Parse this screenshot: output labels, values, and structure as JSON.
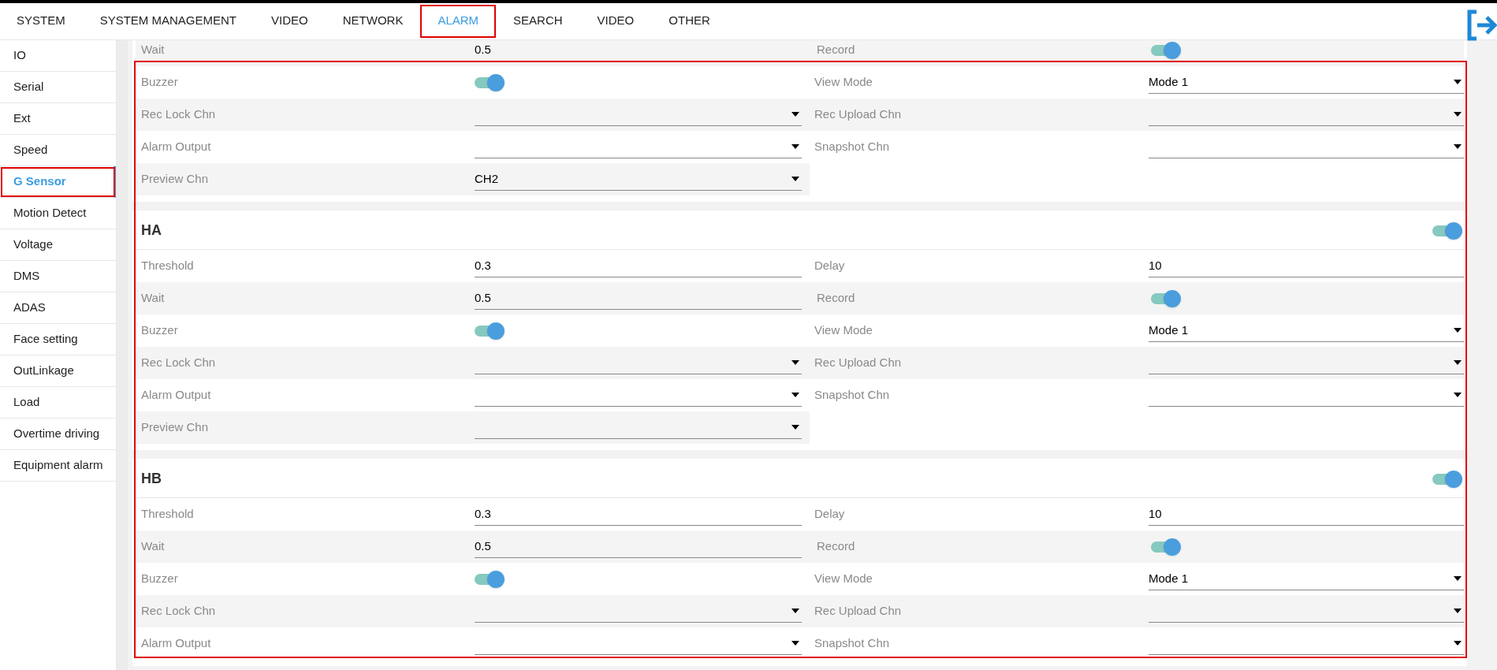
{
  "nav": [
    {
      "label": "SYSTEM",
      "selected": false,
      "highlighted": false
    },
    {
      "label": "SYSTEM MANAGEMENT",
      "selected": false,
      "highlighted": false
    },
    {
      "label": "VIDEO",
      "selected": false,
      "highlighted": false
    },
    {
      "label": "NETWORK",
      "selected": false,
      "highlighted": false
    },
    {
      "label": "ALARM",
      "selected": true,
      "highlighted": true
    },
    {
      "label": "SEARCH",
      "selected": false,
      "highlighted": false
    },
    {
      "label": "VIDEO",
      "selected": false,
      "highlighted": false
    },
    {
      "label": "OTHER",
      "selected": false,
      "highlighted": false
    }
  ],
  "sidebar": {
    "items": [
      {
        "label": "IO",
        "selected": false,
        "highlighted": false
      },
      {
        "label": "Serial",
        "selected": false,
        "highlighted": false
      },
      {
        "label": "Ext",
        "selected": false,
        "highlighted": false
      },
      {
        "label": "Speed",
        "selected": false,
        "highlighted": false
      },
      {
        "label": "G Sensor",
        "selected": true,
        "highlighted": true
      },
      {
        "label": "Motion Detect",
        "selected": false,
        "highlighted": false
      },
      {
        "label": "Voltage",
        "selected": false,
        "highlighted": false
      },
      {
        "label": "DMS",
        "selected": false,
        "highlighted": false
      },
      {
        "label": "ADAS",
        "selected": false,
        "highlighted": false
      },
      {
        "label": "Face setting",
        "selected": false,
        "highlighted": false
      },
      {
        "label": "OutLinkage",
        "selected": false,
        "highlighted": false
      },
      {
        "label": "Load",
        "selected": false,
        "highlighted": false
      },
      {
        "label": "Overtime driving",
        "selected": false,
        "highlighted": false
      },
      {
        "label": "Equipment alarm",
        "selected": false,
        "highlighted": false
      }
    ]
  },
  "annotation_box": true,
  "sections": [
    {
      "rows": [
        [
          {
            "label": "Wait",
            "kind": "text",
            "value": "0.5"
          },
          {
            "label": "Record",
            "kind": "toggle",
            "on": true
          }
        ],
        [
          {
            "label": "Buzzer",
            "kind": "toggle",
            "on": true
          },
          {
            "label": "View Mode",
            "kind": "select",
            "value": "Mode 1"
          }
        ],
        [
          {
            "label": "Rec Lock Chn",
            "kind": "select"
          },
          {
            "label": "Rec Upload Chn",
            "kind": "select"
          }
        ],
        [
          {
            "label": "Alarm Output",
            "kind": "select"
          },
          {
            "label": "Snapshot Chn",
            "kind": "select"
          }
        ],
        [
          {
            "label": "Preview Chn",
            "kind": "select",
            "value": "CH2"
          }
        ]
      ]
    },
    {
      "title": "HA",
      "enabled": true,
      "rows": [
        [
          {
            "label": "Threshold",
            "kind": "text",
            "value": "0.3"
          },
          {
            "label": "Delay",
            "kind": "text",
            "value": "10"
          }
        ],
        [
          {
            "label": "Wait",
            "kind": "text",
            "value": "0.5"
          },
          {
            "label": "Record",
            "kind": "toggle",
            "on": true
          }
        ],
        [
          {
            "label": "Buzzer",
            "kind": "toggle",
            "on": true
          },
          {
            "label": "View Mode",
            "kind": "select",
            "value": "Mode 1"
          }
        ],
        [
          {
            "label": "Rec Lock Chn",
            "kind": "select"
          },
          {
            "label": "Rec Upload Chn",
            "kind": "select"
          }
        ],
        [
          {
            "label": "Alarm Output",
            "kind": "select"
          },
          {
            "label": "Snapshot Chn",
            "kind": "select"
          }
        ],
        [
          {
            "label": "Preview Chn",
            "kind": "select"
          }
        ]
      ]
    },
    {
      "title": "HB",
      "enabled": true,
      "rows": [
        [
          {
            "label": "Threshold",
            "kind": "text",
            "value": "0.3"
          },
          {
            "label": "Delay",
            "kind": "text",
            "value": "10"
          }
        ],
        [
          {
            "label": "Wait",
            "kind": "text",
            "value": "0.5"
          },
          {
            "label": "Record",
            "kind": "toggle",
            "on": true
          }
        ],
        [
          {
            "label": "Buzzer",
            "kind": "toggle",
            "on": true
          },
          {
            "label": "View Mode",
            "kind": "select",
            "value": "Mode 1"
          }
        ],
        [
          {
            "label": "Rec Lock Chn",
            "kind": "select"
          },
          {
            "label": "Rec Upload Chn",
            "kind": "select"
          }
        ],
        [
          {
            "label": "Alarm Output",
            "kind": "select"
          },
          {
            "label": "Snapshot Chn",
            "kind": "select"
          }
        ]
      ]
    }
  ]
}
